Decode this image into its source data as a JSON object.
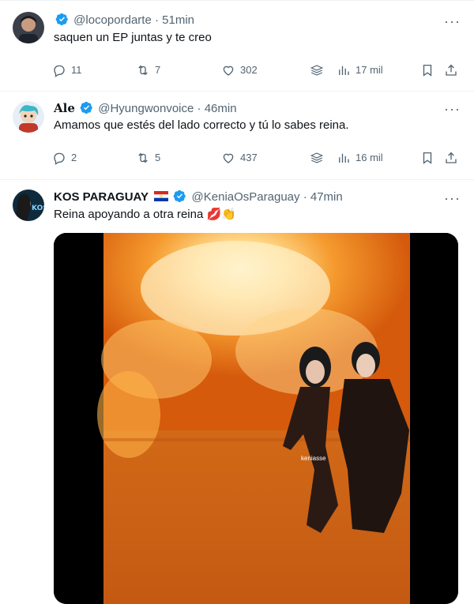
{
  "tweets": [
    {
      "name": "",
      "handle": "@locopordarte",
      "time": "51min",
      "text": "saquen un EP juntas y te creo",
      "replies": "11",
      "retweets": "7",
      "likes": "302",
      "views": "17 mil"
    },
    {
      "name": "Ale",
      "handle": "@Hyungwonvoice",
      "time": "46min",
      "text": "Amamos que estés del lado correcto y tú lo sabes reina.",
      "replies": "2",
      "retweets": "5",
      "likes": "437",
      "views": "16 mil"
    },
    {
      "name": "KOS PARAGUAY",
      "handle": "@KeniaOsParaguay",
      "time": "47min",
      "text": "Reina apoyando a otra reina 💋👏",
      "media_watermark": "keniasse"
    }
  ],
  "separator": "·",
  "more_glyph": "···",
  "colors": {
    "verified": "#1d9bf0",
    "secondary_text": "#536471",
    "primary_text": "#0f1419",
    "divider": "#eff3f4"
  },
  "icons": [
    "verified-badge-icon",
    "reply-icon",
    "retweet-icon",
    "like-icon",
    "grok-icon",
    "views-icon",
    "bookmark-icon",
    "share-icon",
    "more-icon",
    "paraguay-flag-icon"
  ]
}
